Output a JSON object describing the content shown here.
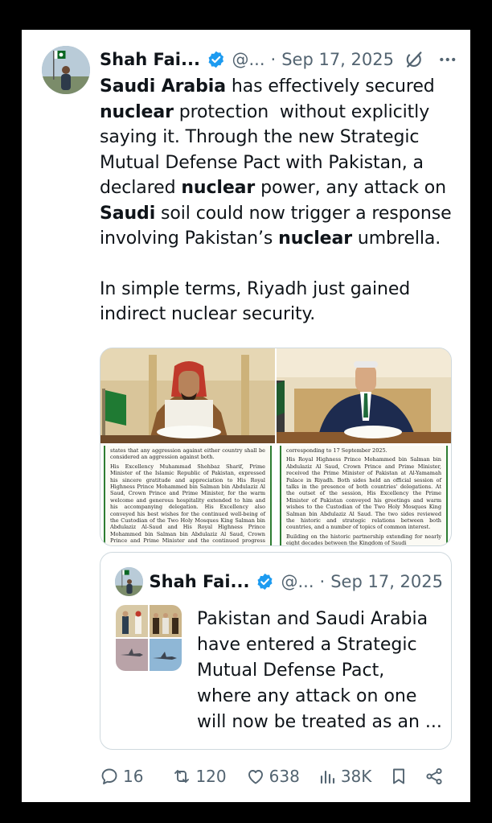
{
  "tweet": {
    "author_name": "Shah Fai...",
    "handle": "@...",
    "separator": "·",
    "date": "Sep 17, 2025",
    "text_html": "<p><b>Saudi Arabia</b> has effectively secured <b>nuclear</b> protection&nbsp; without explicitly saying it. Through the new Strategic Mutual Defense Pact with Pakistan, a declared <b>nuclear</b> power, any attack on <b>Saudi</b> soil could now trigger a response involving Pakistan’s <b>nuclear</b> umbrella.</p><p>In simple terms, Riyadh just gained indirect nuclear security.</p>"
  },
  "media": {
    "left_doc": [
      "states that any aggression against either country shall be considered an aggression against both.",
      "His Excellency Muhammad Shehbaz Sharif, Prime Minister of the Islamic Republic of Pakistan, expressed his sincere gratitude and appreciation to His Royal Highness Prince Mohammed bin Salman bin Abdulaziz Al Saud, Crown Prince and Prime Minister, for the warm welcome and generous hospitality extended to him and his accompanying delegation. His Excellency also conveyed his best wishes for the continued well-being of the Custodian of the Two Holy Mosques King Salman bin Abdulaziz Al-Saud and His Royal Highness Prince Mohammed bin Salman bin Abdulaziz Al Saud, Crown Prince and Prime Minister and the continued progress and prosperity, for the brotherly people of the Kingdom of Saudi Arabia. In turn, His Royal Highness"
    ],
    "right_doc": [
      "corresponding to 17 September 2025.",
      "His Royal Highness Prince Mohammed bin Salman bin Abdulaziz Al Saud, Crown Prince and Prime Minister, received the Prime Minister of Pakistan at Al-Yamamah Palace in Riyadh. Both sides held an official session of talks in the presence of both countries' delegations. At the outset of the session, His Excellency the Prime Minister of Pakistan conveyed his greetings and warm wishes to the Custodian of the Two Holy Mosques King Salman bin Abdulaziz Al Saud. The two sides reviewed the historic and strategic relations between both countries, and a number of topics of common interest.",
      "Building on the historic partnership extending for nearly eight decades between the Kingdom of Saudi"
    ]
  },
  "quote": {
    "author_name": "Shah Fai...",
    "handle": "@...",
    "separator": "·",
    "date": "Sep 17, 2025",
    "text": "Pakistan and Saudi Arabia have entered a Strategic Mutual Defense Pact, where any attack on one will now be treated as an ..."
  },
  "actions": {
    "replies": "16",
    "reposts": "120",
    "likes": "638",
    "views": "38K"
  },
  "colors": {
    "verified": "#1d9bf0",
    "secondary_text": "#536471",
    "border": "#cfd9de"
  },
  "icons": [
    "verified-badge-icon",
    "grok-icon",
    "more-icon",
    "reply-icon",
    "repost-icon",
    "like-icon",
    "views-icon",
    "bookmark-icon",
    "share-icon"
  ]
}
